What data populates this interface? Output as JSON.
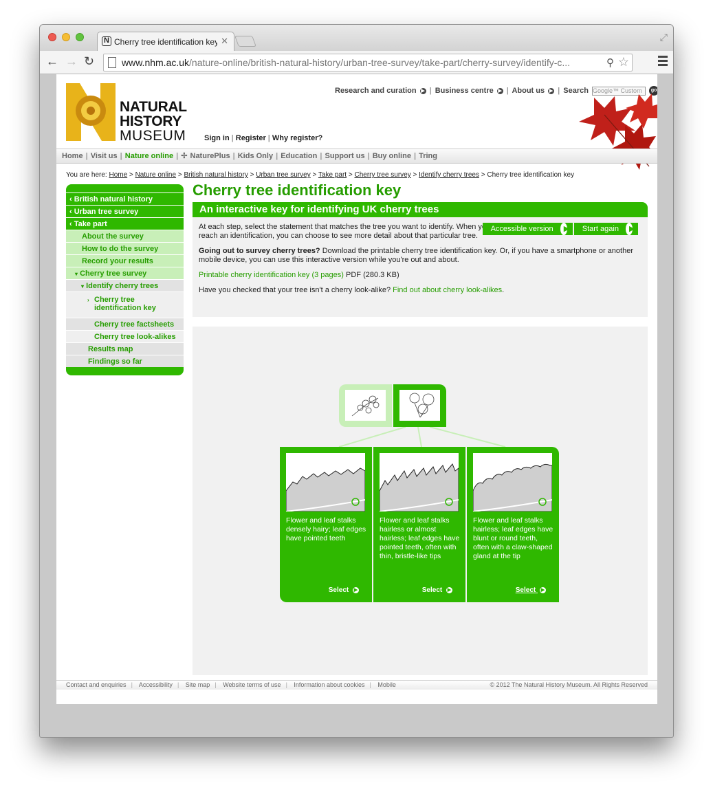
{
  "browser": {
    "tab_title": "Cherry tree identification key",
    "url_domain": "www.nhm.ac.uk",
    "url_path": "/nature-online/british-natural-history/urban-tree-survey/take-part/cherry-survey/identify-c..."
  },
  "logo": {
    "line1": "NATURAL",
    "line2": "HISTORY",
    "line3": "MUSEUM"
  },
  "toplinks": {
    "research": "Research and curation",
    "business": "Business centre",
    "about": "About us",
    "search": "Search",
    "search_placeholder": "Google™ Custom",
    "go": "go"
  },
  "account": {
    "signin": "Sign in",
    "register": "Register",
    "why": "Why register?"
  },
  "topnav": [
    "Home",
    "Visit us",
    "Nature online",
    "NaturePlus",
    "Kids Only",
    "Education",
    "Support us",
    "Buy online",
    "Tring"
  ],
  "breadcrumb": {
    "prefix": "You are here:",
    "items": [
      "Home",
      "Nature online",
      "British natural history",
      "Urban tree survey",
      "Take part",
      "Cherry tree survey",
      "Identify cherry trees"
    ],
    "current": "Cherry tree identification key"
  },
  "sidenav": {
    "l1": "British natural history",
    "l2": "Urban tree survey",
    "l3": "Take part",
    "about": "About the survey",
    "howto": "How to do the survey",
    "record": "Record your results",
    "cherry": "Cherry tree survey",
    "identify": "Identify cherry trees",
    "key": "Cherry tree identification key",
    "factsheets": "Cherry tree factsheets",
    "lookalikes": "Cherry tree look-alikes",
    "results": "Results map",
    "findings": "Findings so far"
  },
  "main": {
    "title": "Cherry tree identification key",
    "subtitle": "An interactive key for identifying UK cherry trees",
    "accessible": "Accessible version",
    "startagain": "Start again",
    "intro": "At each step, select the statement that matches the tree you want to identify. When you reach an identification, you can choose to see more detail about that particular tree.",
    "going_bold": "Going out to survey cherry trees?",
    "going_rest": " Download the printable cherry tree identification key. Or, if you have a smartphone or another mobile device, you can use this interactive version while you're out and about.",
    "pdf_link": "Printable cherry identification key (3 pages)",
    "pdf_size": " PDF (280.3 KB)",
    "lookalike_q": "Have you checked that your tree isn't a cherry look-alike? ",
    "lookalike_link": "Find out about cherry look-alikes",
    "lookalike_end": "."
  },
  "cards": [
    {
      "text": "Flower and leaf stalks densely hairy; leaf edges have pointed teeth",
      "select": "Select"
    },
    {
      "text": "Flower and leaf stalks hairless or almost hairless; leaf edges have pointed teeth, often with thin, bristle-like tips",
      "select": "Select"
    },
    {
      "text": "Flower and leaf stalks hairless; leaf edges have blunt or round teeth, often with a claw-shaped gland at the tip",
      "select": "Select"
    }
  ],
  "footer": {
    "links": [
      "Contact and enquiries",
      "Accessibility",
      "Site map",
      "Website terms of use",
      "Information about cookies",
      "Mobile"
    ],
    "copyright": "© 2012 The Natural History Museum. All Rights Reserved"
  },
  "colors": {
    "green": "#2fb800",
    "text_green": "#269d00",
    "light_green": "#c8efb8"
  }
}
